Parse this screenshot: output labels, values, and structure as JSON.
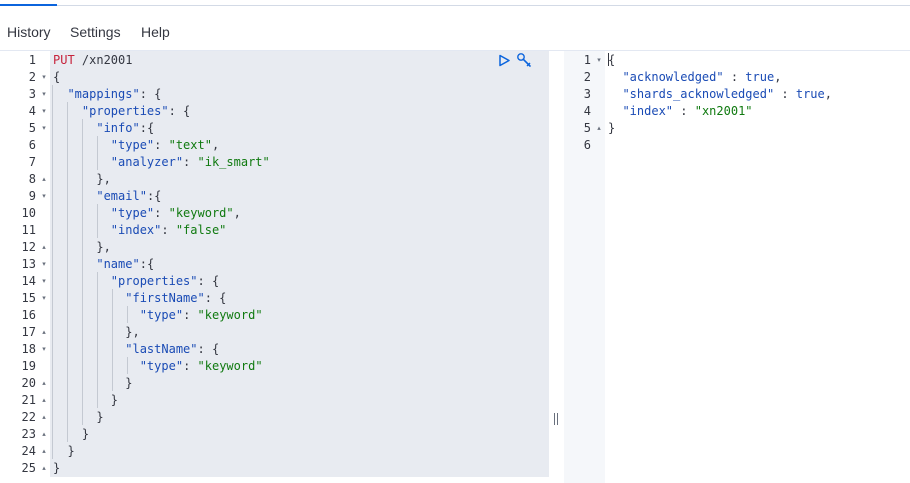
{
  "menu": {
    "history": "History",
    "settings": "Settings",
    "help": "Help"
  },
  "colors": {
    "accent": "#0b64dd",
    "key": "#1a4bb5",
    "string": "#107a10",
    "method": "#c6223b",
    "run": "#0b64dd"
  },
  "request": {
    "lines": [
      [
        [
          "m",
          "PUT"
        ],
        [
          "p",
          " /xn2001"
        ]
      ],
      [
        [
          "p",
          "{"
        ]
      ],
      [
        [
          "p",
          "  "
        ],
        [
          "k",
          "\"mappings\""
        ],
        [
          "p",
          ": {"
        ]
      ],
      [
        [
          "p",
          "    "
        ],
        [
          "k",
          "\"properties\""
        ],
        [
          "p",
          ": {"
        ]
      ],
      [
        [
          "p",
          "      "
        ],
        [
          "k",
          "\"info\""
        ],
        [
          "p",
          ":{"
        ]
      ],
      [
        [
          "p",
          "        "
        ],
        [
          "k",
          "\"type\""
        ],
        [
          "p",
          ": "
        ],
        [
          "s",
          "\"text\""
        ],
        [
          "p",
          ","
        ]
      ],
      [
        [
          "p",
          "        "
        ],
        [
          "k",
          "\"analyzer\""
        ],
        [
          "p",
          ": "
        ],
        [
          "s",
          "\"ik_smart\""
        ]
      ],
      [
        [
          "p",
          "      },"
        ]
      ],
      [
        [
          "p",
          "      "
        ],
        [
          "k",
          "\"email\""
        ],
        [
          "p",
          ":{"
        ]
      ],
      [
        [
          "p",
          "        "
        ],
        [
          "k",
          "\"type\""
        ],
        [
          "p",
          ": "
        ],
        [
          "s",
          "\"keyword\""
        ],
        [
          "p",
          ","
        ]
      ],
      [
        [
          "p",
          "        "
        ],
        [
          "k",
          "\"index\""
        ],
        [
          "p",
          ": "
        ],
        [
          "s",
          "\"false\""
        ]
      ],
      [
        [
          "p",
          "      },"
        ]
      ],
      [
        [
          "p",
          "      "
        ],
        [
          "k",
          "\"name\""
        ],
        [
          "p",
          ":{"
        ]
      ],
      [
        [
          "p",
          "        "
        ],
        [
          "k",
          "\"properties\""
        ],
        [
          "p",
          ": {"
        ]
      ],
      [
        [
          "p",
          "          "
        ],
        [
          "k",
          "\"firstName\""
        ],
        [
          "p",
          ": {"
        ]
      ],
      [
        [
          "p",
          "            "
        ],
        [
          "k",
          "\"type\""
        ],
        [
          "p",
          ": "
        ],
        [
          "s",
          "\"keyword\""
        ]
      ],
      [
        [
          "p",
          "          },"
        ]
      ],
      [
        [
          "p",
          "          "
        ],
        [
          "k",
          "\"lastName\""
        ],
        [
          "p",
          ": {"
        ]
      ],
      [
        [
          "p",
          "            "
        ],
        [
          "k",
          "\"type\""
        ],
        [
          "p",
          ": "
        ],
        [
          "s",
          "\"keyword\""
        ]
      ],
      [
        [
          "p",
          "          }"
        ]
      ],
      [
        [
          "p",
          "        }"
        ]
      ],
      [
        [
          "p",
          "      }"
        ]
      ],
      [
        [
          "p",
          "    }"
        ]
      ],
      [
        [
          "p",
          "  }"
        ]
      ],
      [
        [
          "p",
          "}"
        ]
      ]
    ],
    "line_numbers": [
      "1",
      "2",
      "3",
      "4",
      "5",
      "6",
      "7",
      "8",
      "9",
      "10",
      "11",
      "12",
      "13",
      "14",
      "15",
      "16",
      "17",
      "18",
      "19",
      "20",
      "21",
      "22",
      "23",
      "24",
      "25"
    ],
    "fold_markers": [
      "",
      "open",
      "open",
      "open",
      "open",
      "",
      "",
      "close",
      "open",
      "",
      "",
      "close",
      "open",
      "open",
      "open",
      "",
      "close",
      "open",
      "",
      "close",
      "close",
      "close",
      "close",
      "close",
      "close"
    ],
    "active_line": 13
  },
  "response": {
    "lines": [
      [
        [
          "p",
          "{"
        ]
      ],
      [
        [
          "p",
          "  "
        ],
        [
          "k",
          "\"acknowledged\""
        ],
        [
          "p",
          " : "
        ],
        [
          "b",
          "true"
        ],
        [
          "p",
          ","
        ]
      ],
      [
        [
          "p",
          "  "
        ],
        [
          "k",
          "\"shards_acknowledged\""
        ],
        [
          "p",
          " : "
        ],
        [
          "b",
          "true"
        ],
        [
          "p",
          ","
        ]
      ],
      [
        [
          "p",
          "  "
        ],
        [
          "k",
          "\"index\""
        ],
        [
          "p",
          " : "
        ],
        [
          "s",
          "\"xn2001\""
        ]
      ],
      [
        [
          "p",
          "}"
        ]
      ],
      [
        [
          "p",
          ""
        ]
      ]
    ],
    "line_numbers": [
      "1",
      "2",
      "3",
      "4",
      "5",
      "6"
    ],
    "fold_markers": [
      "open",
      "",
      "",
      "",
      "close",
      ""
    ]
  },
  "icons": {
    "run": "play-icon",
    "settings": "wrench-icon"
  }
}
